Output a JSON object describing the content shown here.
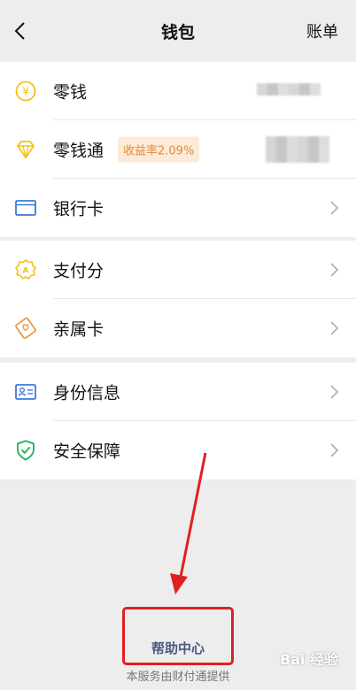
{
  "nav": {
    "title": "钱包",
    "bill_label": "账单"
  },
  "groups": [
    {
      "items": [
        {
          "label": "零钱",
          "icon": "coin-icon"
        },
        {
          "label": "零钱通",
          "icon": "diamond-icon",
          "badge": "收益率2.09%"
        },
        {
          "label": "银行卡",
          "icon": "bank-card-icon"
        }
      ]
    },
    {
      "items": [
        {
          "label": "支付分",
          "icon": "pay-score-icon"
        },
        {
          "label": "亲属卡",
          "icon": "family-card-icon"
        }
      ]
    },
    {
      "items": [
        {
          "label": "身份信息",
          "icon": "id-card-icon"
        },
        {
          "label": "安全保障",
          "icon": "shield-icon"
        }
      ]
    }
  ],
  "footer": {
    "help_label": "帮助中心",
    "provider_text": "本服务由财付通提供"
  },
  "watermark": "Bai 经验",
  "colors": {
    "accent_yellow": "#f2c218",
    "accent_blue": "#3a7bd5",
    "accent_green": "#17b45a",
    "accent_orange": "#e39a4a",
    "highlight_red": "#e02020"
  }
}
